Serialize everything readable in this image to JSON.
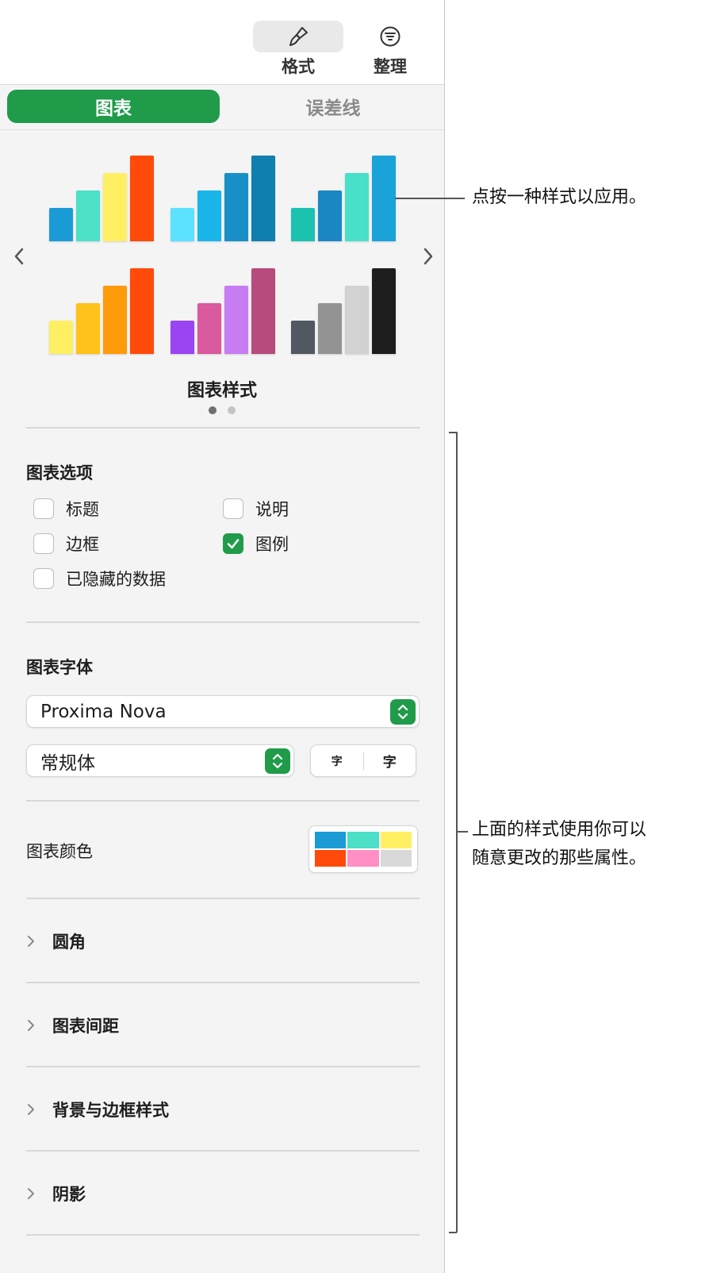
{
  "toolbar": {
    "format_label": "格式",
    "organize_label": "整理"
  },
  "tabs": {
    "chart": "图表",
    "error_bars": "误差线"
  },
  "gallery": {
    "title": "图表样式",
    "page_count": 2,
    "current_page": 1,
    "styles": [
      {
        "colors": [
          "#1a9bd6",
          "#4be0c7",
          "#fff063",
          "#ff4a0a"
        ]
      },
      {
        "colors": [
          "#5ce1ff",
          "#1ab6ea",
          "#1890c7",
          "#0f7fb0"
        ]
      },
      {
        "colors": [
          "#1cc2b0",
          "#1b87c2",
          "#48e0c8",
          "#1aa3d9"
        ]
      },
      {
        "colors": [
          "#fff063",
          "#ffc21a",
          "#ff9a0a",
          "#ff4a0a"
        ]
      },
      {
        "colors": [
          "#9a44f2",
          "#d95a9e",
          "#c87cf2",
          "#b84b7e"
        ]
      },
      {
        "colors": [
          "#525861",
          "#939393",
          "#d2d2d2",
          "#1e1e1e"
        ]
      }
    ]
  },
  "chart_options": {
    "title": "图表选项",
    "items": [
      {
        "label": "标题",
        "checked": false
      },
      {
        "label": "说明",
        "checked": false
      },
      {
        "label": "边框",
        "checked": false
      },
      {
        "label": "图例",
        "checked": true
      },
      {
        "label": "已隐藏的数据",
        "checked": false
      }
    ]
  },
  "chart_font": {
    "title": "图表字体",
    "family": "Proxima Nova",
    "style": "常规体",
    "size_smaller": "字",
    "size_larger": "字"
  },
  "chart_colors": {
    "label": "图表颜色",
    "swatches": [
      "#1a9bd6",
      "#4be0c7",
      "#fff063",
      "#ff4a0a",
      "#ff8fc4",
      "#d9d9d9"
    ]
  },
  "collapsible_sections": [
    "圆角",
    "图表间距",
    "背景与边框样式",
    "阴影"
  ],
  "callouts": {
    "style_hint": "点按一种样式以应用。",
    "properties_hint_line1": "上面的样式使用你可以",
    "properties_hint_line2": "随意更改的那些属性。"
  },
  "icons": {
    "format": "paintbrush-icon",
    "organize": "filter-lines-icon",
    "prev": "chevron-left-icon",
    "next": "chevron-right-icon",
    "stepper": "up-down-chevron-icon",
    "disclosure": "chevron-right-icon",
    "check": "checkmark-icon"
  }
}
